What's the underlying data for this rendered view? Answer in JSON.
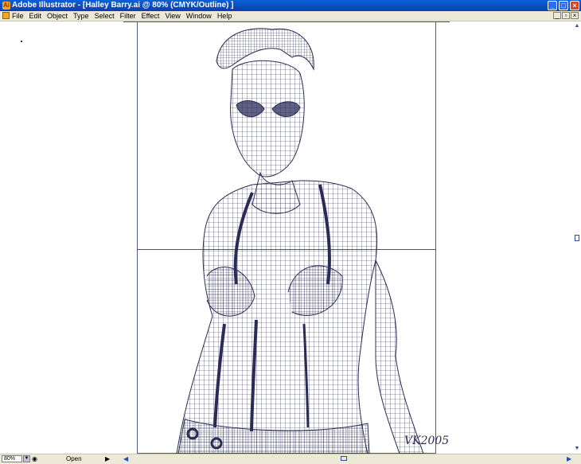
{
  "window": {
    "title": "Adobe Illustrator - [Halley Barry.ai @ 80% (CMYK/Outline) ]",
    "controls": [
      "minimize",
      "maximize",
      "close"
    ]
  },
  "menubar": {
    "items": [
      "File",
      "Edit",
      "Object",
      "Type",
      "Select",
      "Filter",
      "Effect",
      "View",
      "Window",
      "Help"
    ]
  },
  "document": {
    "artwork_signature": "VK2005",
    "stroke_color": "#2b2b55"
  },
  "statusbar": {
    "zoom": "80%",
    "status": "Open"
  },
  "colors": {
    "titlebar": "#0a4fc8",
    "chrome": "#ece9d8",
    "guide": "#4a4aa8",
    "wireframe": "#2b2b55"
  }
}
